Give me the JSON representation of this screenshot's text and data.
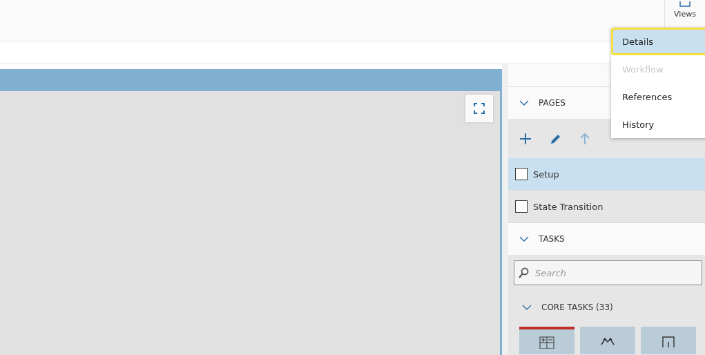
{
  "toolbar": {
    "views_button": {
      "label": "Views"
    }
  },
  "views_menu": [
    {
      "label": "Details",
      "selected": true,
      "disabled": false
    },
    {
      "label": "Workflow",
      "selected": false,
      "disabled": true
    },
    {
      "label": "References",
      "selected": false,
      "disabled": false
    },
    {
      "label": "History",
      "selected": false,
      "disabled": false
    }
  ],
  "pages_section": {
    "title": "PAGES",
    "expanded": true,
    "pages": [
      {
        "label": "Setup",
        "selected": true,
        "checked": false
      },
      {
        "label": "State Transition",
        "selected": false,
        "checked": false
      }
    ]
  },
  "tasks_section": {
    "title": "TASKS",
    "expanded": true,
    "search": {
      "placeholder": "Search"
    },
    "groups": [
      {
        "title": "CORE TASKS (33)",
        "expanded": true,
        "tiles": [
          {
            "kind": "grid",
            "selected": true
          },
          {
            "kind": "branch",
            "selected": false
          },
          {
            "kind": "step",
            "selected": false
          }
        ]
      }
    ]
  }
}
